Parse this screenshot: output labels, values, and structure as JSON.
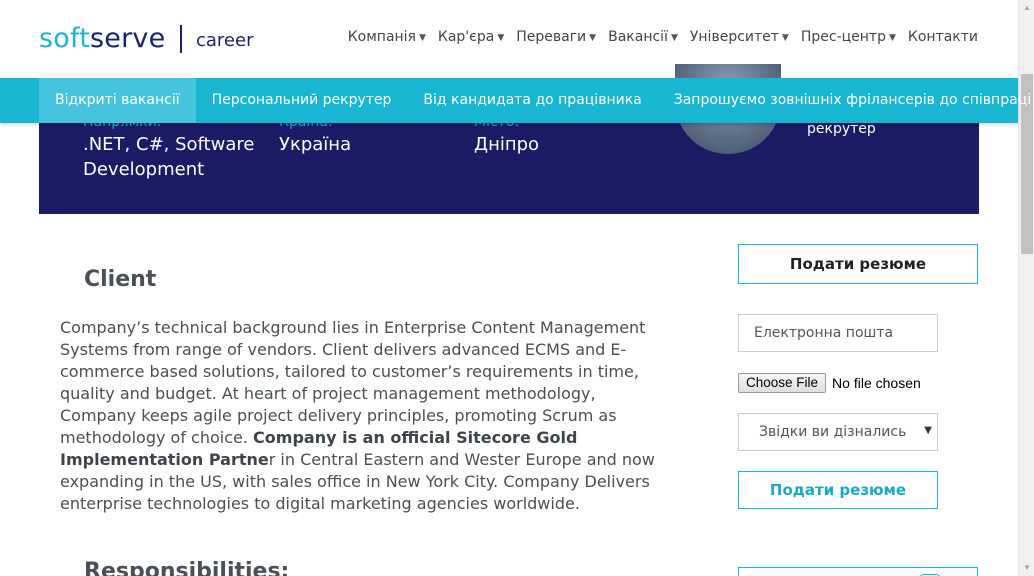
{
  "header": {
    "logo_soft": "soft",
    "logo_serve": "serve",
    "logo_career": "career",
    "nav": [
      {
        "label": "Компанія",
        "has_dropdown": true
      },
      {
        "label": "Кар'єра",
        "has_dropdown": true
      },
      {
        "label": "Переваги",
        "has_dropdown": true
      },
      {
        "label": "Вакансії",
        "has_dropdown": true
      },
      {
        "label": "Університет",
        "has_dropdown": true
      },
      {
        "label": "Прес-центр",
        "has_dropdown": true
      },
      {
        "label": "Контакти",
        "has_dropdown": false
      }
    ]
  },
  "subnav": {
    "items": [
      {
        "label": "Відкриті вакансії",
        "active": true
      },
      {
        "label": "Персональний рекрутер",
        "active": false
      },
      {
        "label": "Від кандидата до працівника",
        "active": false
      },
      {
        "label": "Запрошуємо зовнішніх фрілансерів до співпраці",
        "active": false
      }
    ]
  },
  "banner": {
    "directions_label": "Напрямки:",
    "directions_value": ".NET, C#, Software Development",
    "country_label": "Країна:",
    "country_value": "Україна",
    "city_label": "Місто:",
    "city_value": "Дніпро",
    "recruiter_role": "рекрутер"
  },
  "content": {
    "client_title": "Client",
    "client_text_1": "Company’s technical background lies in Enterprise Content Management Systems from range of vendors. Client delivers advanced ECMS and E-commerce based solutions, tailored to customer’s requirements in time, quality and budget. At heart of project management methodology, Company keeps agile project delivery principles, promoting Scrum as methodology of choice.",
    "client_text_bold": "Company is an official Sitecore Gold Implementation Partne",
    "client_text_2": "r in Central Eastern and Wester Europe and now expanding in the US, with sales office in New York City. Company Delivers enterprise technologies to digital marketing agencies worldwide.",
    "responsibilities_title": "Responsibilities:"
  },
  "form": {
    "top_button": "Подати резюме",
    "email_placeholder": "Електронна пошта",
    "file_button": "Choose File",
    "file_status": "No file chosen",
    "source_select": "Звідки ви дізнались пр",
    "submit_button": "Подати резюме"
  },
  "colors": {
    "accent_cyan": "#19b6d4",
    "banner_navy": "#1b1b66",
    "logo_navy": "#1b2370"
  }
}
